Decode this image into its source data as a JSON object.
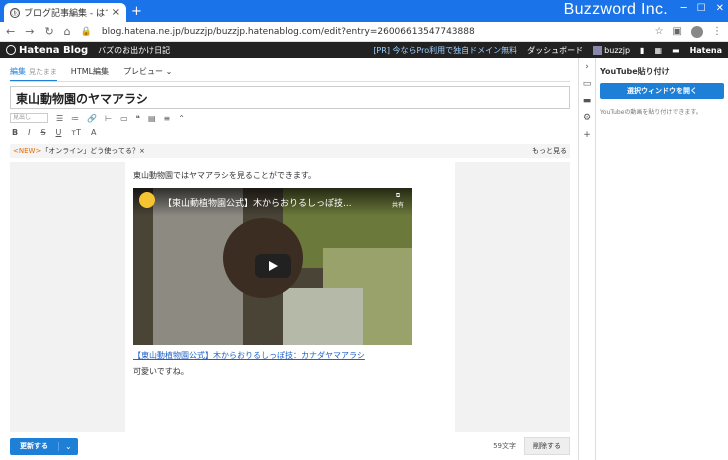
{
  "browser": {
    "tab_title": "ブログ記事編集 - はてなブログ",
    "tab_close": "×",
    "new_tab": "+",
    "url": "blog.hatena.ne.jp/buzzjp/buzzjp.hatenablog.com/edit?entry=26006613547743888",
    "watermark": "Buzzword Inc."
  },
  "header": {
    "logo": "Hatena Blog",
    "blog_name": "バズのお出かけ日記",
    "promo": "[PR] 今ならPro利用で独自ドメイン無料",
    "dashboard": "ダッシュボード",
    "user": "buzzjp",
    "hatena": "Hatena"
  },
  "editor": {
    "tabs": [
      {
        "label": "編集",
        "sub": "見たまま"
      },
      {
        "label": "HTML編集"
      },
      {
        "label": "プレビュー"
      }
    ],
    "title": "東山動物園のヤマアラシ",
    "heading_select": "見出し",
    "tip_new": "<NEW>",
    "tip_text": "「オンライン」どう使ってる？×",
    "tip_more": "もっと見る",
    "para1": "東山動物園ではヤマアラシを見ることができます。",
    "video_title": "【東山動植物園公式】木からおりるしっぽ技...",
    "video_share": "共有",
    "link": "【東山動植物園公式】木からおりるしっぽ技：カナダヤマアラシ",
    "para2": "可愛いですね。",
    "update": "更新する",
    "chars": "59文字",
    "delete": "削除する"
  },
  "sidebar": {
    "title": "YouTube貼り付け",
    "button": "選択ウィンドウを開く",
    "desc": "YouTubeの動画を貼り付けできます。"
  }
}
